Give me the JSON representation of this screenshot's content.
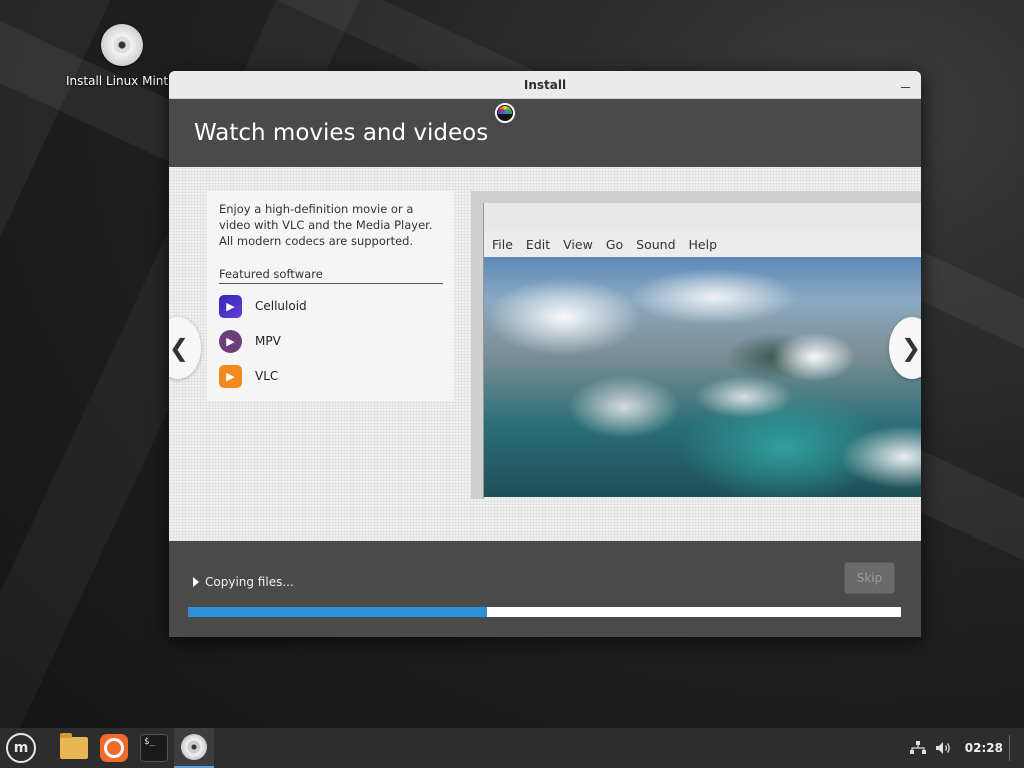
{
  "desktop": {
    "icon_label": "Install Linux Mint"
  },
  "window": {
    "title": "Install",
    "heading": "Watch movies and videos",
    "slide": {
      "description": "Enjoy a high-definition movie or a video with VLC and the Media Player. All modern codecs are supported.",
      "featured_label": "Featured software",
      "apps": [
        {
          "name": "Celluloid",
          "icon": "celluloid-icon"
        },
        {
          "name": "MPV",
          "icon": "mpv-icon"
        },
        {
          "name": "VLC",
          "icon": "vlc-icon"
        }
      ],
      "prev_glyph": "❮",
      "next_glyph": "❯",
      "player_menu": [
        "File",
        "Edit",
        "View",
        "Go",
        "Sound",
        "Help"
      ]
    },
    "footer": {
      "status": "Copying files...",
      "skip_label": "Skip",
      "progress_fraction": 0.42
    }
  },
  "taskbar": {
    "logo_glyph": "m",
    "terminal_glyph": "$_",
    "clock": "02:28"
  },
  "colors": {
    "accent": "#2e8fd6",
    "header": "#4a4a4a",
    "taskbar": "#2d2d2d"
  }
}
